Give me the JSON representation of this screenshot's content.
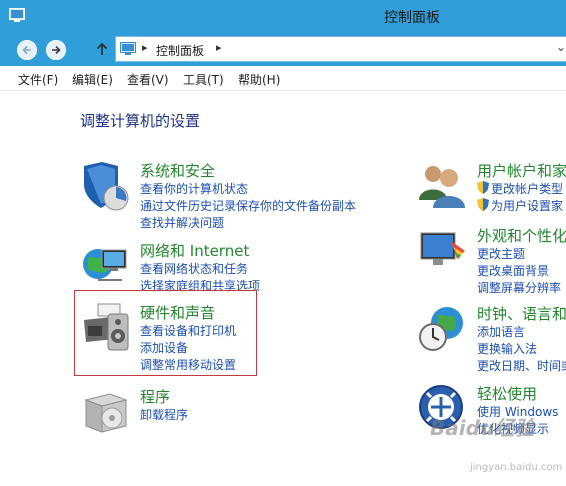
{
  "window": {
    "title": "控制面板"
  },
  "address": {
    "location": "控制面板"
  },
  "menu": {
    "items": [
      "文件(F)",
      "编辑(E)",
      "查看(V)",
      "工具(T)",
      "帮助(H)"
    ]
  },
  "main": {
    "heading": "调整计算机的设置",
    "categories_left": [
      {
        "title": "系统和安全",
        "icon": "security-shield-icon",
        "links": [
          "查看你的计算机状态",
          "通过文件历史记录保存你的文件备份副本",
          "查找并解决问题"
        ]
      },
      {
        "title": "网络和 Internet",
        "icon": "network-globe-icon",
        "links": [
          "查看网络状态和任务",
          "选择家庭组和共享选项"
        ]
      },
      {
        "title": "硬件和声音",
        "icon": "printer-speaker-icon",
        "links": [
          "查看设备和打印机",
          "添加设备",
          "调整常用移动设置"
        ]
      },
      {
        "title": "程序",
        "icon": "programs-box-icon",
        "links": [
          "卸载程序"
        ]
      }
    ],
    "categories_right": [
      {
        "title": "用户帐户和家",
        "icon": "user-accounts-icon",
        "links": [
          "更改帐户类型",
          "为用户设置家"
        ]
      },
      {
        "title": "外观和个性化",
        "icon": "display-paint-icon",
        "links": [
          "更改主题",
          "更改桌面背景",
          "调整屏幕分辨率"
        ]
      },
      {
        "title": "时钟、语言和",
        "icon": "clock-globe-icon",
        "links": [
          "添加语言",
          "更换输入法",
          "更改日期、时间或"
        ]
      },
      {
        "title": "轻松使用",
        "icon": "ease-of-access-icon",
        "links": [
          "使用 Windows",
          "优化视频显示"
        ]
      }
    ]
  },
  "watermark": {
    "text": "Baidu经验",
    "sub": "jingyan.baidu.com"
  }
}
